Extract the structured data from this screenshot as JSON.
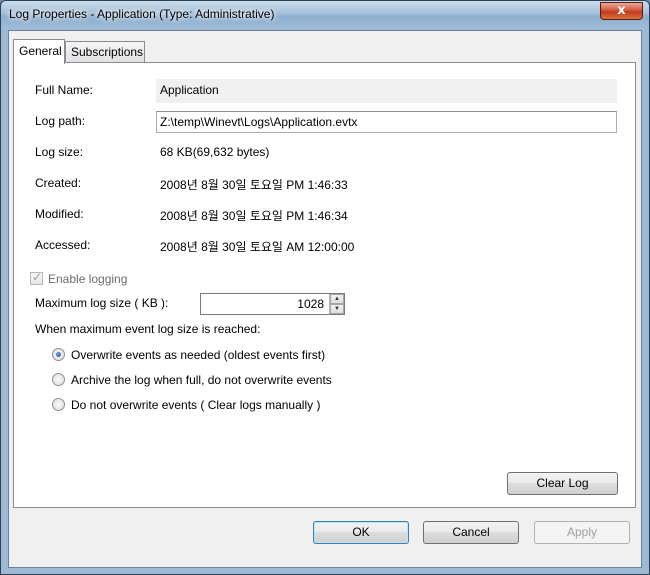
{
  "window": {
    "title": "Log Properties - Application (Type: Administrative)",
    "close_glyph": "x"
  },
  "tabs": [
    {
      "label": "General",
      "active": true
    },
    {
      "label": "Subscriptions",
      "active": false
    }
  ],
  "general": {
    "full_name_label": "Full Name:",
    "full_name_value": "Application",
    "log_path_label": "Log path:",
    "log_path_value": "Z:\\temp\\Winevt\\Logs\\Application.evtx",
    "log_size_label": "Log size:",
    "log_size_value": "68 KB(69,632 bytes)",
    "created_label": "Created:",
    "created_value": "2008년 8월 30일 토요일 PM 1:46:33",
    "modified_label": "Modified:",
    "modified_value": "2008년 8월 30일 토요일 PM 1:46:34",
    "accessed_label": "Accessed:",
    "accessed_value": "2008년 8월 30일 토요일 AM 12:00:00",
    "enable_logging_label": "Enable logging",
    "enable_logging_checked": true,
    "max_size_label": "Maximum log size ( KB ):",
    "max_size_value": "1028",
    "when_max_label": "When maximum event log size is reached:",
    "options": [
      {
        "label": "Overwrite events as needed (oldest events first)",
        "selected": true
      },
      {
        "label": "Archive the log when full, do not overwrite events",
        "selected": false
      },
      {
        "label": "Do not overwrite events ( Clear logs manually )",
        "selected": false
      }
    ],
    "clear_log_label": "Clear Log"
  },
  "footer": {
    "ok_label": "OK",
    "cancel_label": "Cancel",
    "apply_label": "Apply"
  }
}
